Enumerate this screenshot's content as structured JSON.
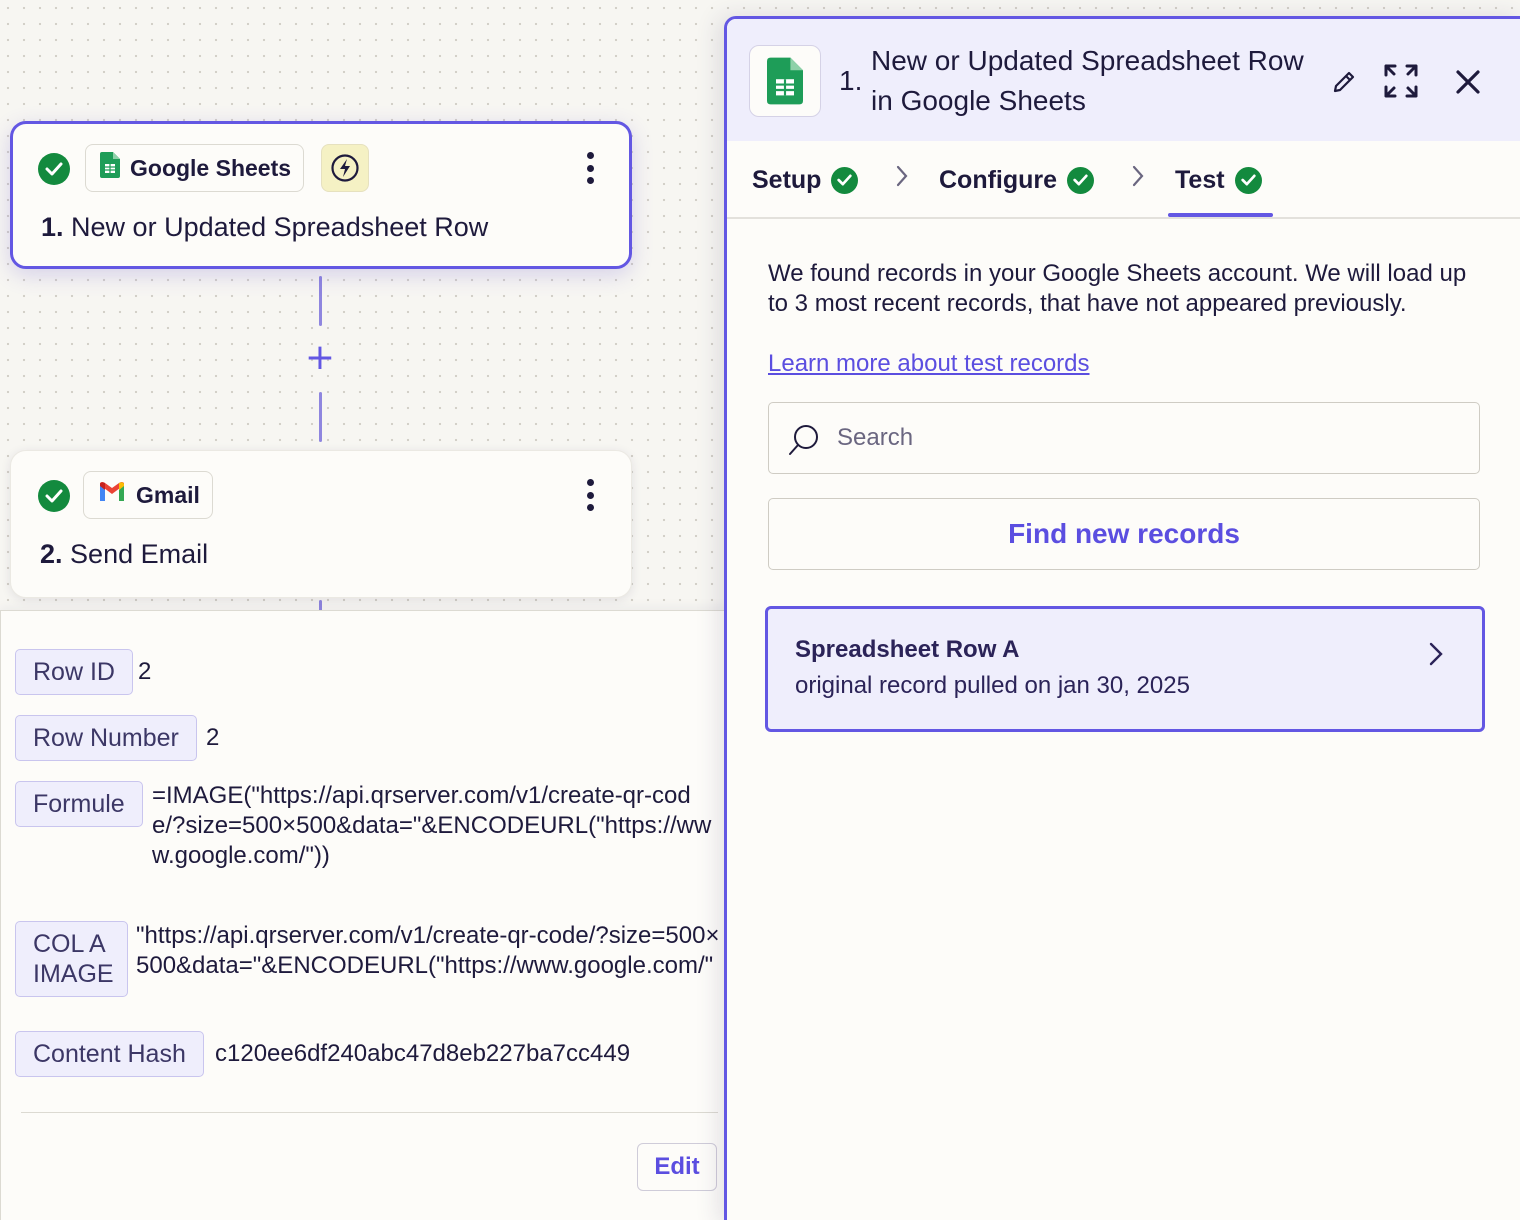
{
  "canvas": {
    "steps": [
      {
        "number": "1.",
        "title": "New or Updated Spreadsheet Row",
        "app": "Google Sheets",
        "app_icon": "google-sheets-icon",
        "trigger_icon": "lightning-icon",
        "status": "complete"
      },
      {
        "number": "2.",
        "title": "Send Email",
        "app": "Gmail",
        "app_icon": "gmail-icon",
        "status": "complete"
      }
    ],
    "add_step_icon": "plus-icon"
  },
  "record_details": {
    "fields": [
      {
        "label": "Row ID",
        "value": "2"
      },
      {
        "label": "Row Number",
        "value": "2"
      },
      {
        "label": "Formule",
        "value": "=IMAGE(\"https://api.qrserver.com/v1/create-qr-code/?size=500×500&data=\"&ENCODEURL(\"https://www.google.com/\"))"
      },
      {
        "label": "COL A IMAGE",
        "value": "\"https://api.qrserver.com/v1/create-qr-code/?size=500×500&data=\"&ENCODEURL(\"https://www.google.com/\""
      },
      {
        "label": "Content Hash",
        "value": "c120ee6df240abc47d8eb227ba7cc449"
      }
    ],
    "edit_label": "Edit"
  },
  "drawer": {
    "step_number": "1.",
    "title": "New or Updated Spreadsheet Row in Google Sheets",
    "tabs": [
      {
        "label": "Setup",
        "status": "complete"
      },
      {
        "label": "Configure",
        "status": "complete"
      },
      {
        "label": "Test",
        "status": "complete",
        "active": true
      }
    ],
    "intro": "We found records in your Google Sheets account. We will load up to 3 most recent records, that have not appeared previously.",
    "learn_more": "Learn more about test records",
    "search": {
      "placeholder": "Search",
      "value": ""
    },
    "find_button": "Find new records",
    "records": [
      {
        "title": "Spreadsheet Row A",
        "subtitle": "original record pulled on jan 30, 2025"
      }
    ]
  },
  "colors": {
    "accent": "#6357e3",
    "success": "#138a3e",
    "sheets_green": "#1e9d58",
    "selected_bg": "#efeefc"
  }
}
